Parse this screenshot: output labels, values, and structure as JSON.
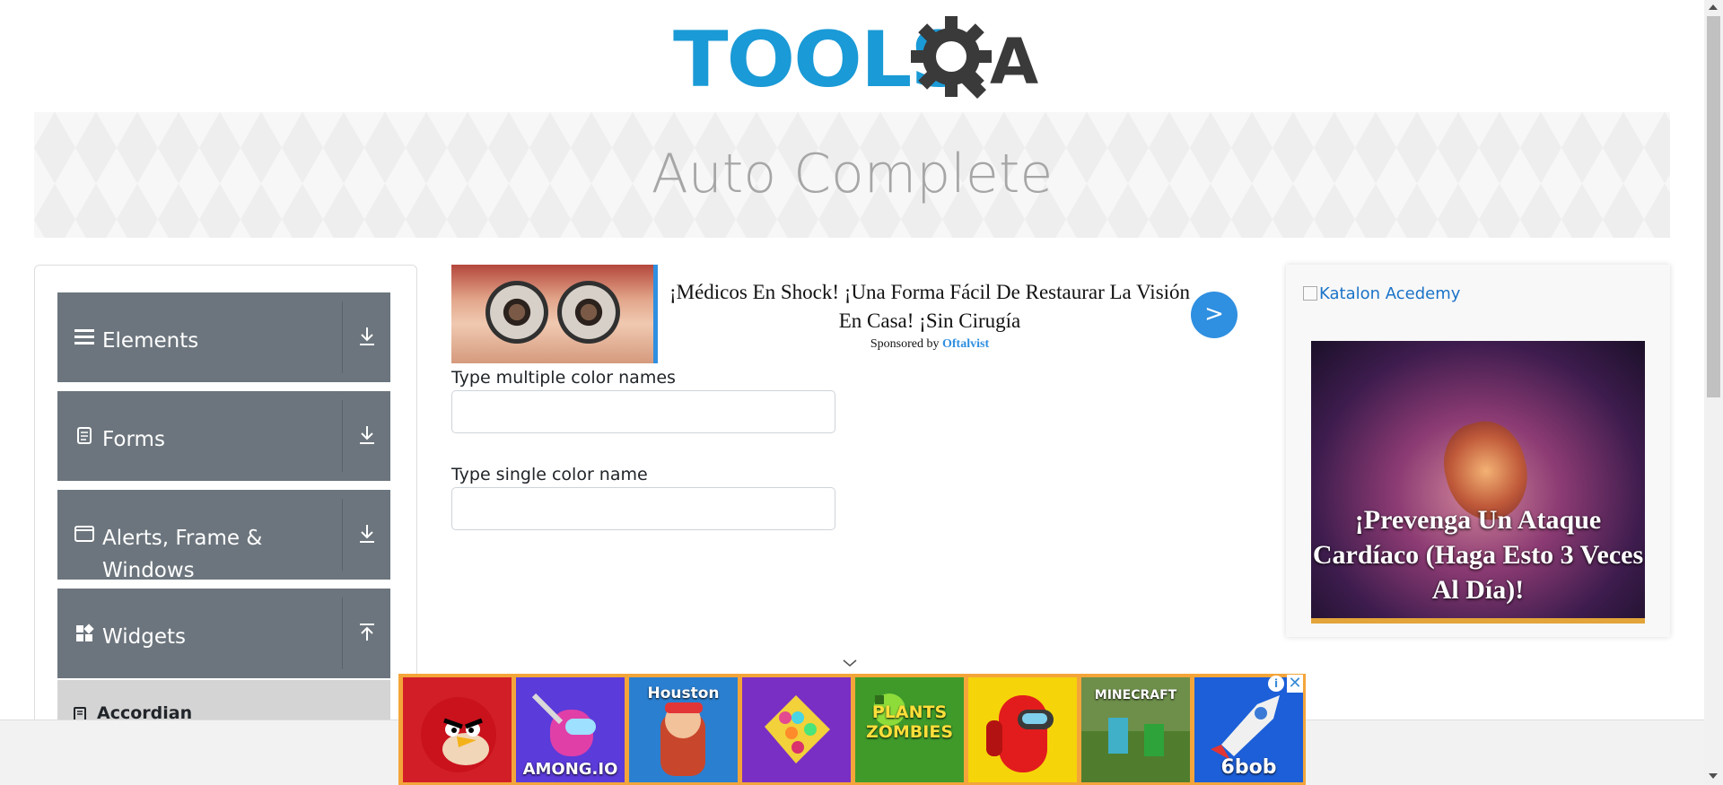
{
  "logo": {
    "text": "TOOLS",
    "suffix": "A"
  },
  "page": {
    "title": "Auto Complete"
  },
  "sidebar": {
    "groups": [
      {
        "label": "Elements",
        "icon": "hamburger-icon",
        "toggle": "download-icon"
      },
      {
        "label": "Forms",
        "icon": "form-doc-icon",
        "toggle": "download-icon"
      },
      {
        "label": "Alerts, Frame & Windows",
        "icon": "window-icon",
        "toggle": "download-icon"
      },
      {
        "label": "Widgets",
        "icon": "widgets-icon",
        "toggle": "upload-icon"
      }
    ],
    "active_item": {
      "label": "Accordian",
      "icon": "list-doc-icon"
    }
  },
  "ad_top": {
    "headline": "¡Médicos En Shock! ¡Una Forma Fácil De Restaurar La Visión En Casa! ¡Sin Cirugía",
    "sponsored_prefix": "Sponsored by",
    "sponsor": "Oftalvist",
    "cta": ">"
  },
  "form": {
    "multiple_label": "Type multiple color names",
    "multiple_value": "",
    "single_label": "Type single color name",
    "single_value": ""
  },
  "right_ad": {
    "image_alt": "Katalon Acedemy",
    "headline": "¡Prevenga Un Ataque Cardíaco (Haga Esto 3 Veces Al Día)!"
  },
  "game_ad": {
    "tiles": [
      {
        "label": "",
        "icon": "angry-bird-icon",
        "color": "#d21f27"
      },
      {
        "label": "AMONG.IO",
        "icon": "among-io-icon",
        "color": "#5b3bd9"
      },
      {
        "label": "Houston",
        "icon": "subway-surfers-icon",
        "color": "#2a7fd1"
      },
      {
        "label": "",
        "icon": "pop-it-icon",
        "color": "#7a2fc4"
      },
      {
        "label": "PLANTS ZOMBIES",
        "icon": "plants-zombies-icon",
        "color": "#3f9a2a"
      },
      {
        "label": "",
        "icon": "among-us-icon",
        "color": "#f5d40a"
      },
      {
        "label": "MINECRAFT",
        "icon": "minecraft-icon",
        "color": "#6e8f4a"
      },
      {
        "label": "6bob",
        "icon": "rocket-icon",
        "color": "#1c5fd8"
      }
    ],
    "info": "i",
    "close": "✕"
  },
  "colors": {
    "sidebar": "#6c757d",
    "logo_blue": "#1a9ad6",
    "logo_dark": "#3a3a3a",
    "link": "#1a73c8"
  }
}
